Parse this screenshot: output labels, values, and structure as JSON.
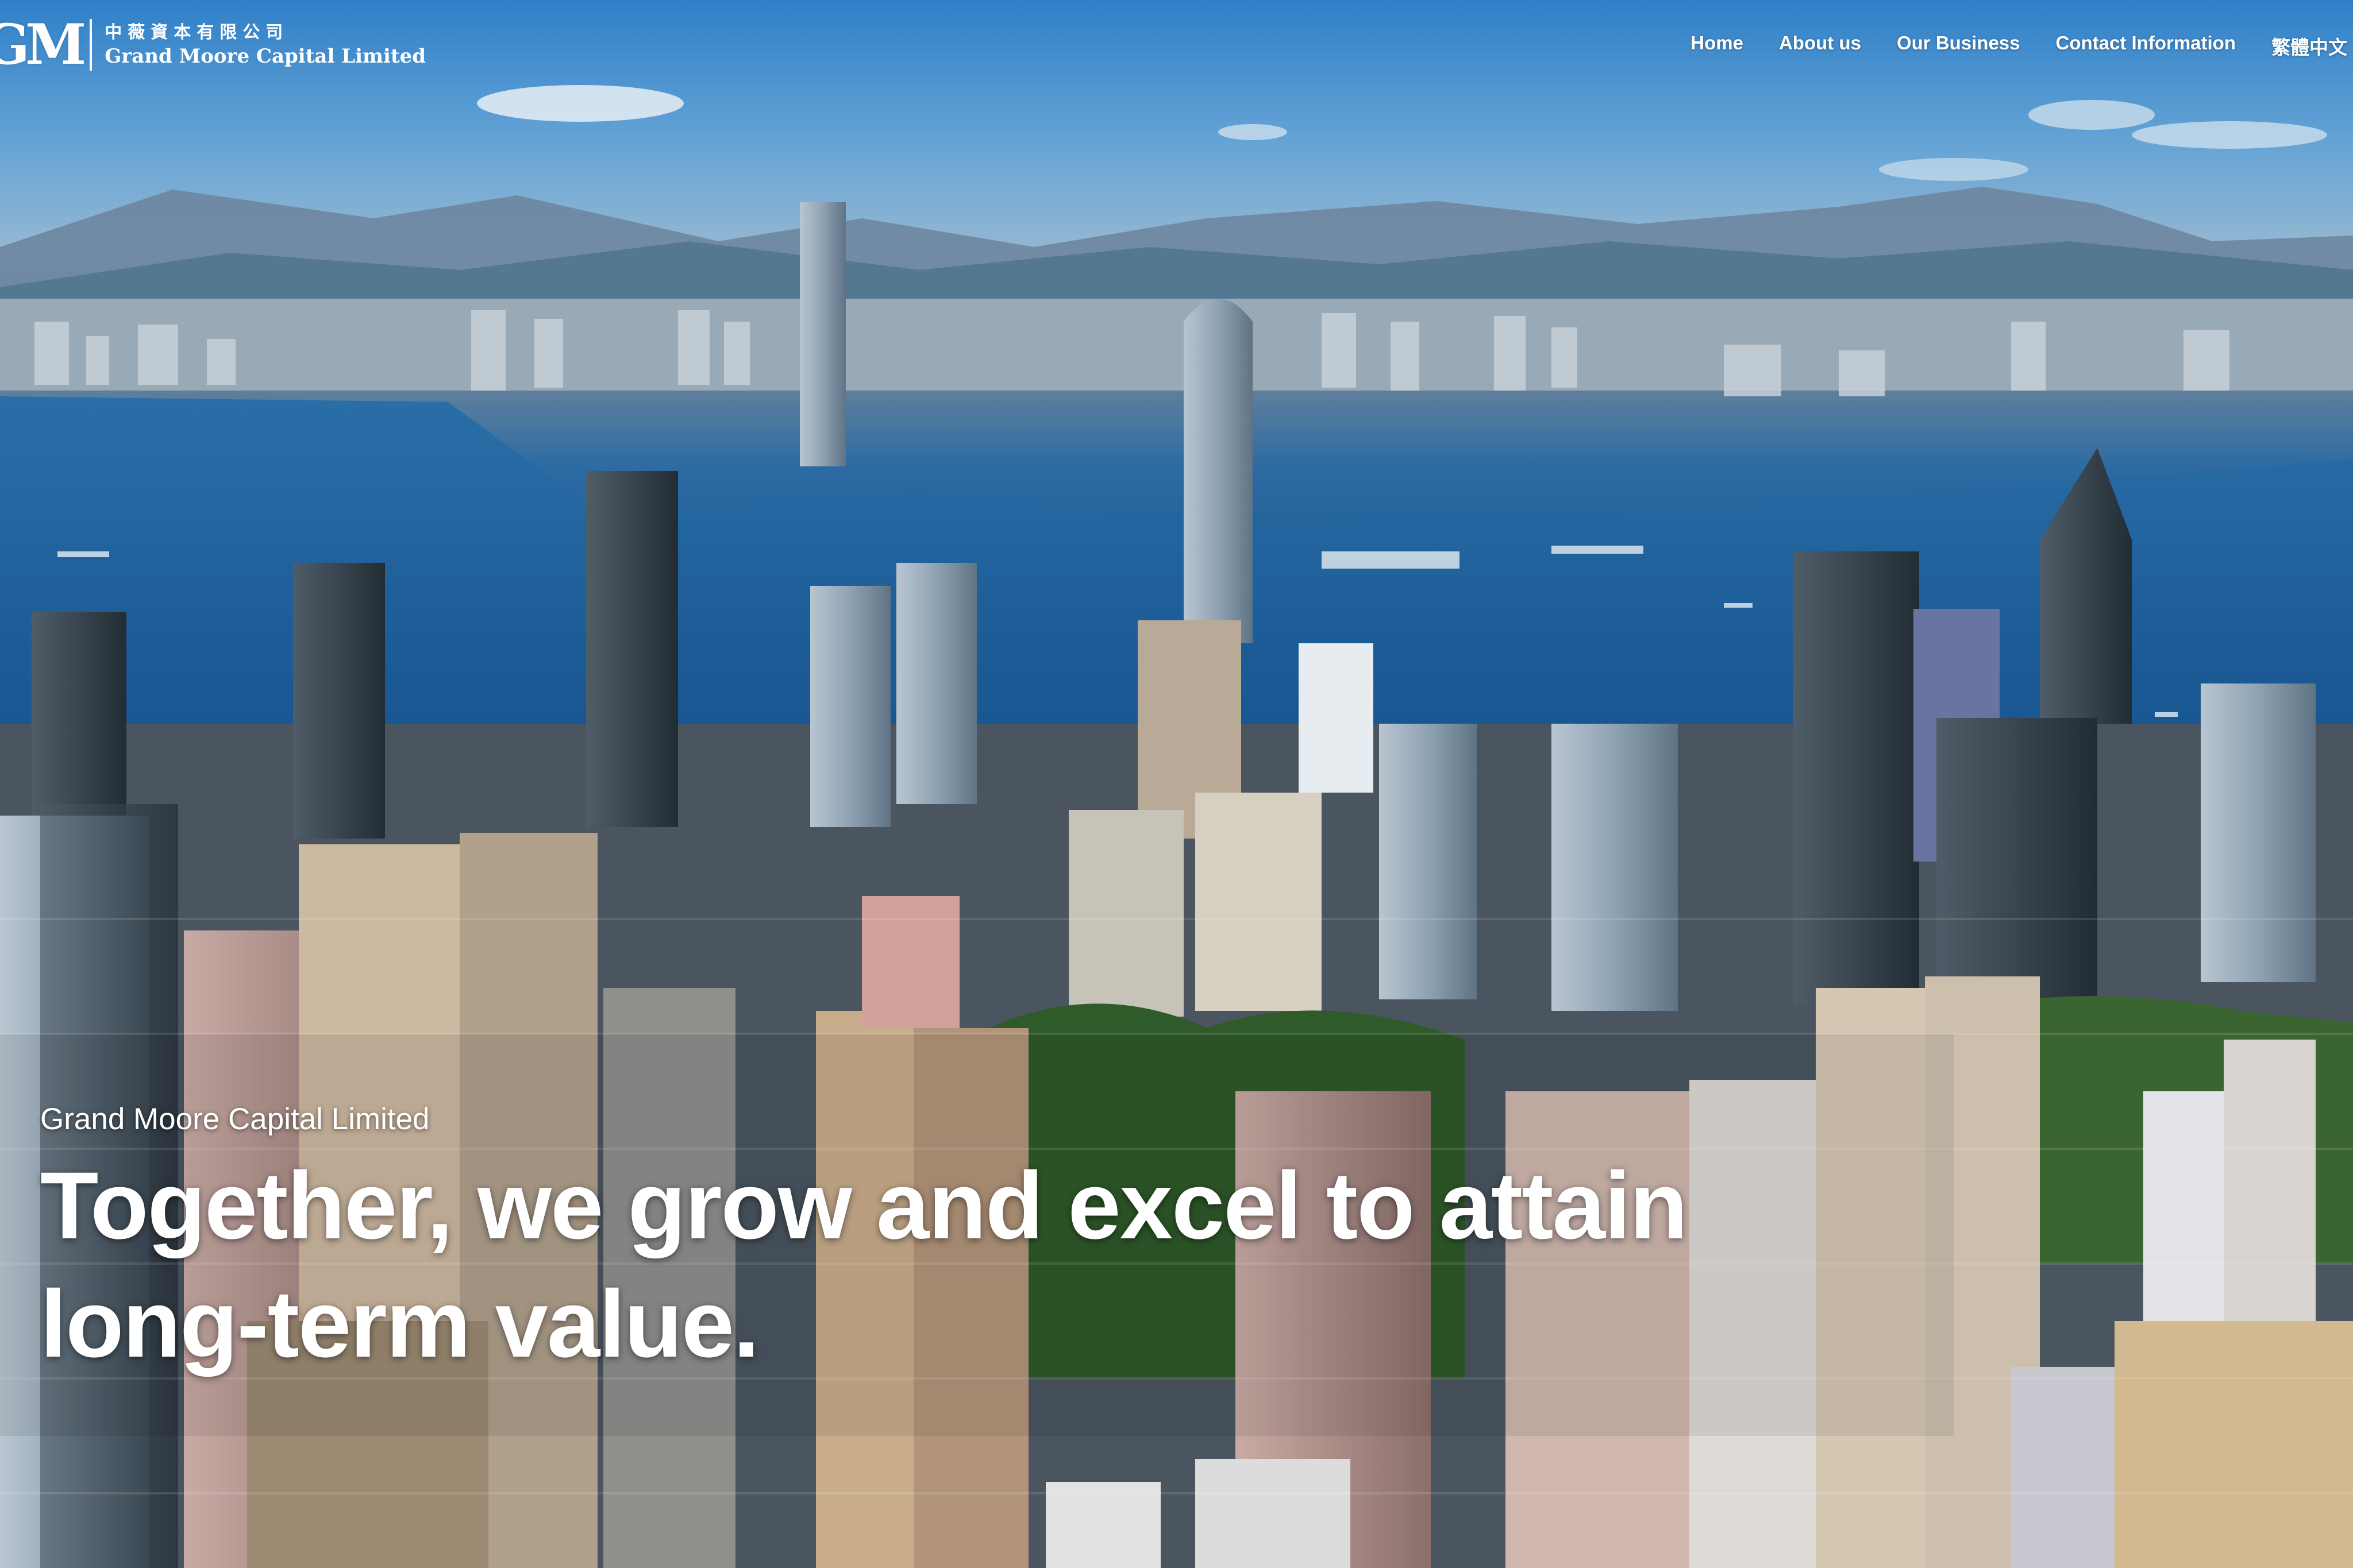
{
  "brand": {
    "logo_mark": "GM",
    "name_cn": "中薇資本有限公司",
    "name_en": "Grand Moore Capital Limited"
  },
  "nav": {
    "items": [
      {
        "label": "Home"
      },
      {
        "label": "About us"
      },
      {
        "label": "Our Business"
      },
      {
        "label": "Contact Information"
      },
      {
        "label": "繁體中文"
      }
    ]
  },
  "hero": {
    "eyebrow": "Grand Moore Capital Limited",
    "headline": "Together, we grow and excel to attain long-term value.",
    "background": "aerial view of Hong Kong skyline and Victoria Harbour"
  },
  "colors": {
    "text": "#ffffff",
    "sky": "#4f9bd8",
    "harbour": "#1c5d97"
  }
}
